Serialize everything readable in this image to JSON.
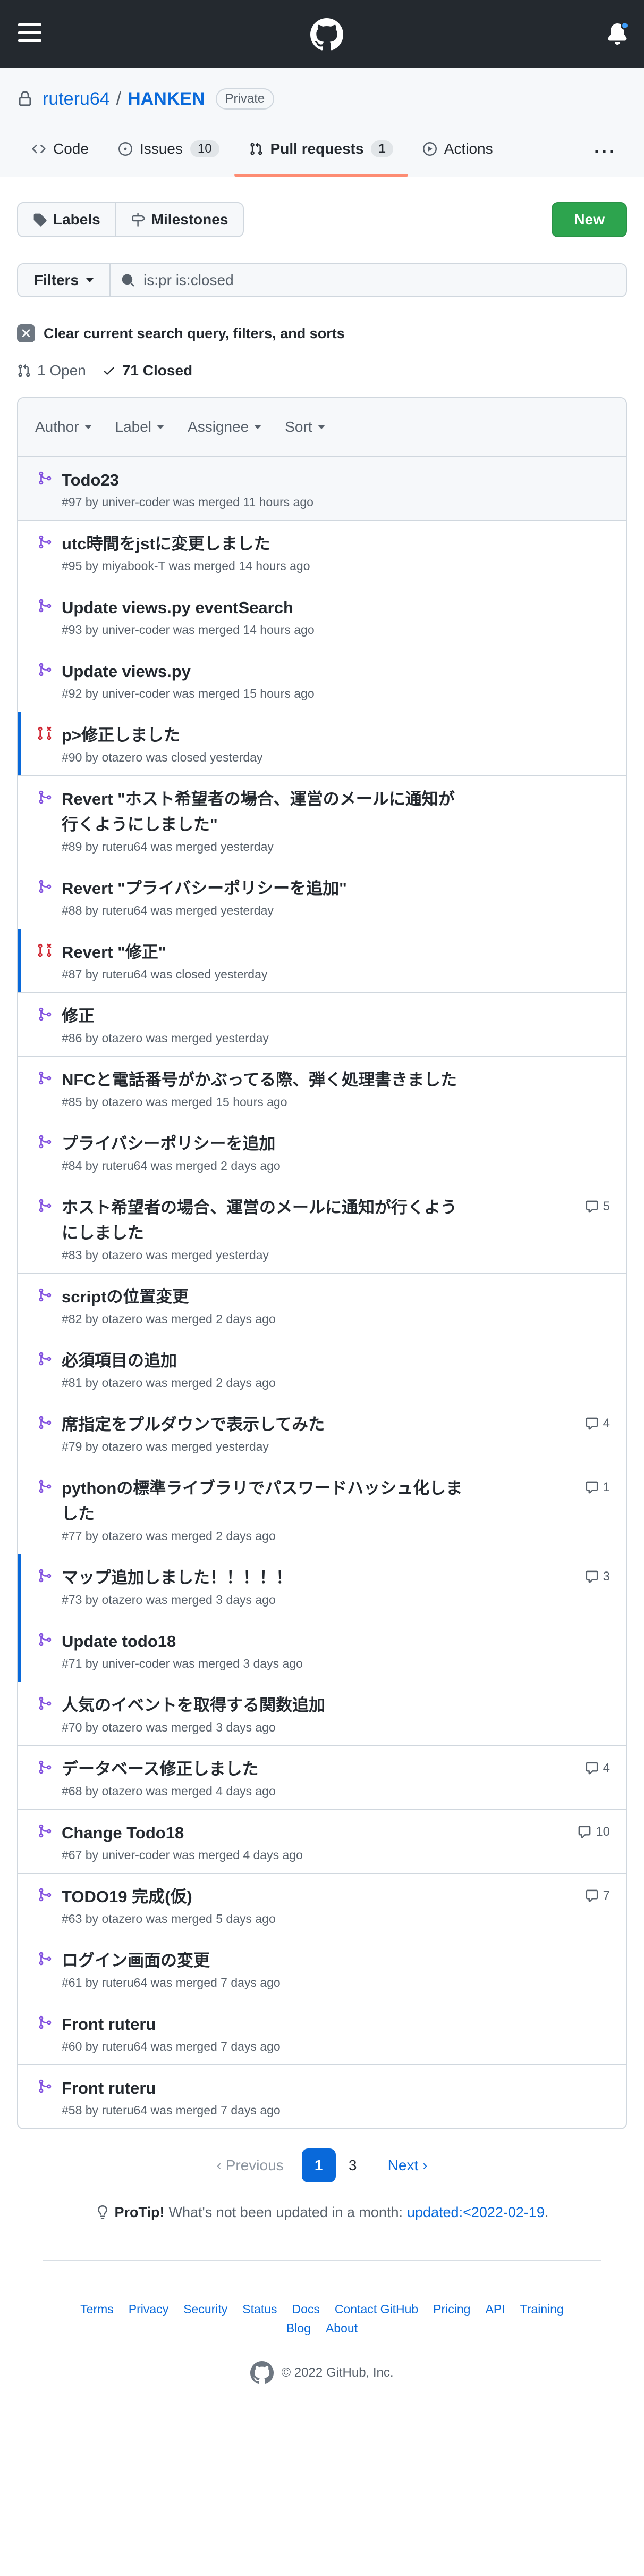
{
  "repo": {
    "owner": "ruteru64",
    "separator": "/",
    "name": "HANKEN",
    "visibility": "Private"
  },
  "tabs": [
    {
      "label": "Code",
      "icon": "code-icon"
    },
    {
      "label": "Issues",
      "count": "10",
      "icon": "issue-icon"
    },
    {
      "label": "Pull requests",
      "count": "1",
      "icon": "pull-request-icon",
      "selected": true
    },
    {
      "label": "Actions",
      "icon": "play-icon"
    }
  ],
  "toolbar": {
    "labels": "Labels",
    "milestones": "Milestones",
    "new": "New"
  },
  "filters": {
    "button": "Filters",
    "query": "is:pr is:closed"
  },
  "clear_text": "Clear current search query, filters, and sorts",
  "states": {
    "open": "1 Open",
    "closed": "71 Closed"
  },
  "list_header": {
    "author": "Author",
    "label": "Label",
    "assignee": "Assignee",
    "sort": "Sort"
  },
  "pull_requests": [
    {
      "title": "Todo23",
      "meta": "#97 by univer-coder was merged 11 hours ago",
      "status": "merged",
      "comments": ""
    },
    {
      "title": "utc時間をjstに変更しました",
      "meta": "#95 by miyabook-T was merged 14 hours ago",
      "status": "merged",
      "comments": ""
    },
    {
      "title": "Update views.py eventSearch",
      "meta": "#93 by univer-coder was merged 14 hours ago",
      "status": "merged",
      "comments": ""
    },
    {
      "title": "Update views.py",
      "meta": "#92 by univer-coder was merged 15 hours ago",
      "status": "merged",
      "comments": ""
    },
    {
      "title": "p>修正しました",
      "meta": "#90 by otazero was closed yesterday",
      "status": "closed",
      "comments": ""
    },
    {
      "title": "Revert \"ホスト希望者の場合、運営のメールに通知が行くようにしました\"",
      "meta": "#89 by ruteru64 was merged yesterday",
      "status": "merged",
      "comments": ""
    },
    {
      "title": "Revert \"プライバシーポリシーを追加\"",
      "meta": "#88 by ruteru64 was merged yesterday",
      "status": "merged",
      "comments": ""
    },
    {
      "title": "Revert \"修正\"",
      "meta": "#87 by ruteru64 was closed yesterday",
      "status": "closed",
      "comments": ""
    },
    {
      "title": "修正",
      "meta": "#86 by otazero was merged yesterday",
      "status": "merged",
      "comments": ""
    },
    {
      "title": "NFCと電話番号がかぶってる際、弾く処理書きました",
      "meta": "#85 by otazero was merged 15 hours ago",
      "status": "merged",
      "comments": ""
    },
    {
      "title": "プライバシーポリシーを追加",
      "meta": "#84 by ruteru64 was merged 2 days ago",
      "status": "merged",
      "comments": ""
    },
    {
      "title": "ホスト希望者の場合、運営のメールに通知が行くようにしました",
      "meta": "#83 by otazero was merged yesterday",
      "status": "merged",
      "comments": "5"
    },
    {
      "title": "scriptの位置変更",
      "meta": "#82 by otazero was merged 2 days ago",
      "status": "merged",
      "comments": ""
    },
    {
      "title": "必須項目の追加",
      "meta": "#81 by otazero was merged 2 days ago",
      "status": "merged",
      "comments": ""
    },
    {
      "title": "席指定をプルダウンで表示してみた",
      "meta": "#79 by otazero was merged yesterday",
      "status": "merged",
      "comments": "4"
    },
    {
      "title": "pythonの標準ライブラリでパスワードハッシュ化しました",
      "meta": "#77 by otazero was merged 2 days ago",
      "status": "merged",
      "comments": "1"
    },
    {
      "title": "マップ追加しました！！！！！",
      "meta": "#73 by otazero was merged 3 days ago",
      "status": "merged",
      "comments": "3"
    },
    {
      "title": "Update todo18",
      "meta": "#71 by univer-coder was merged 3 days ago",
      "status": "merged",
      "comments": ""
    },
    {
      "title": "人気のイベントを取得する関数追加",
      "meta": "#70 by otazero was merged 3 days ago",
      "status": "merged",
      "comments": ""
    },
    {
      "title": "データベース修正しました",
      "meta": "#68 by otazero was merged 4 days ago",
      "status": "merged",
      "comments": "4"
    },
    {
      "title": "Change Todo18",
      "meta": "#67 by univer-coder was merged 4 days ago",
      "status": "merged",
      "comments": "10"
    },
    {
      "title": "TODO19 完成(仮)",
      "meta": "#63 by otazero was merged 5 days ago",
      "status": "merged",
      "comments": "7"
    },
    {
      "title": "ログイン画面の変更",
      "meta": "#61 by ruteru64 was merged 7 days ago",
      "status": "merged",
      "comments": ""
    },
    {
      "title": "Front ruteru",
      "meta": "#60 by ruteru64 was merged 7 days ago",
      "status": "merged",
      "comments": ""
    },
    {
      "title": "Front ruteru",
      "meta": "#58 by ruteru64 was merged 7 days ago",
      "status": "merged",
      "comments": ""
    }
  ],
  "pagination": {
    "previous": "Previous",
    "pages": [
      "1",
      "3"
    ],
    "current": "1",
    "next": "Next"
  },
  "protip": {
    "label": "ProTip!",
    "text": "What's not been updated in a month:",
    "link": "updated:<2022-02-19",
    "end": "."
  },
  "footer": {
    "links": [
      "Terms",
      "Privacy",
      "Security",
      "Status",
      "Docs",
      "Contact GitHub",
      "Pricing",
      "API",
      "Training",
      "Blog",
      "About"
    ],
    "copyright": "© 2022 GitHub, Inc."
  },
  "colors": {
    "merged": "#8250df",
    "closed": "#cf222e",
    "link": "#0969da",
    "accent_tab": "#fd8c73",
    "new_button": "#2da44e"
  }
}
